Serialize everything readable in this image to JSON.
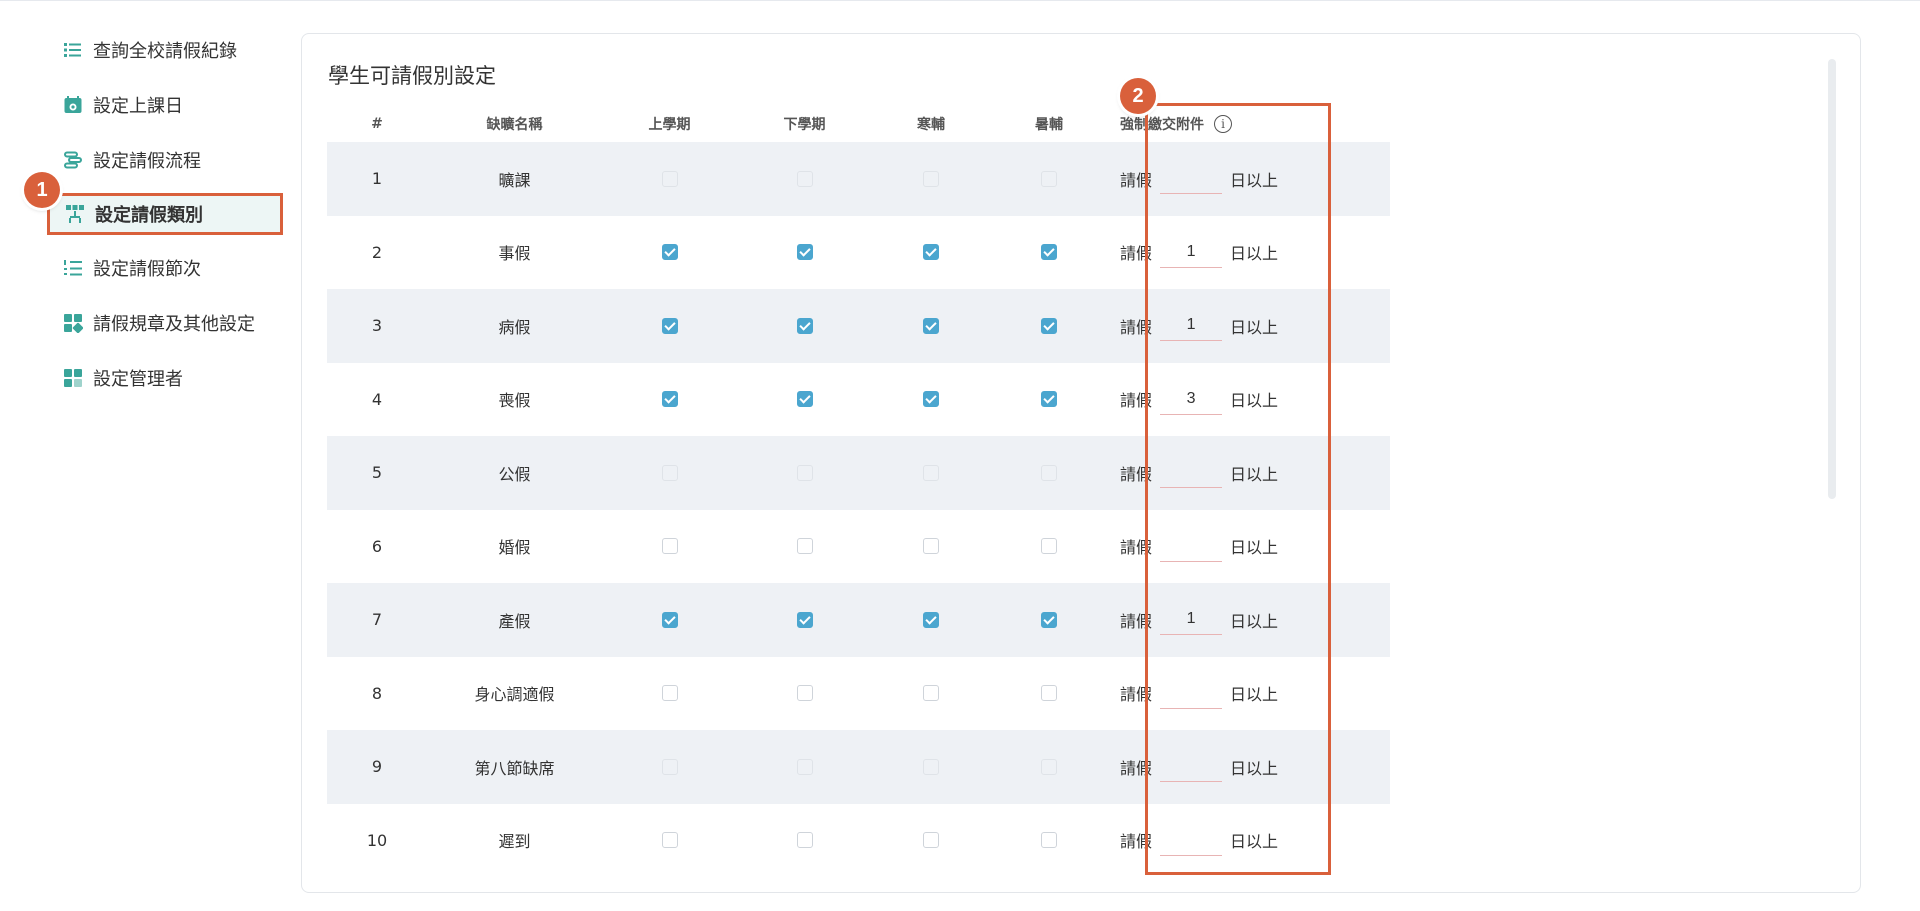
{
  "sidebar": {
    "items": [
      {
        "label": "查詢全校請假紀錄",
        "icon": "list-icon",
        "active": false
      },
      {
        "label": "設定上課日",
        "icon": "calendar-icon",
        "active": false
      },
      {
        "label": "設定請假流程",
        "icon": "flow-icon",
        "active": false
      },
      {
        "label": "設定請假類別",
        "icon": "category-icon",
        "active": true
      },
      {
        "label": "設定請假節次",
        "icon": "numbered-list-icon",
        "active": false
      },
      {
        "label": "請假規章及其他設定",
        "icon": "grid-icon",
        "active": false
      },
      {
        "label": "設定管理者",
        "icon": "admin-icon",
        "active": false
      }
    ]
  },
  "badges": {
    "one": "1",
    "two": "2"
  },
  "card": {
    "title": "學生可請假別設定"
  },
  "table": {
    "headers": {
      "num": "#",
      "name": "缺曠名稱",
      "sem1": "上學期",
      "sem2": "下學期",
      "winter": "寒輔",
      "summer": "暑輔",
      "attachment": "強制繳交附件",
      "info_icon": "i"
    },
    "attachment_prefix": "請假",
    "attachment_suffix": "日以上",
    "rows": [
      {
        "num": "1",
        "name": "曠課",
        "checks": [
          false,
          false,
          false,
          false
        ],
        "disabled": true,
        "days": ""
      },
      {
        "num": "2",
        "name": "事假",
        "checks": [
          true,
          true,
          true,
          true
        ],
        "disabled": false,
        "days": "1"
      },
      {
        "num": "3",
        "name": "病假",
        "checks": [
          true,
          true,
          true,
          true
        ],
        "disabled": false,
        "days": "1"
      },
      {
        "num": "4",
        "name": "喪假",
        "checks": [
          true,
          true,
          true,
          true
        ],
        "disabled": false,
        "days": "3"
      },
      {
        "num": "5",
        "name": "公假",
        "checks": [
          false,
          false,
          false,
          false
        ],
        "disabled": true,
        "days": ""
      },
      {
        "num": "6",
        "name": "婚假",
        "checks": [
          false,
          false,
          false,
          false
        ],
        "disabled": false,
        "days": ""
      },
      {
        "num": "7",
        "name": "產假",
        "checks": [
          true,
          true,
          true,
          true
        ],
        "disabled": false,
        "days": "1"
      },
      {
        "num": "8",
        "name": "身心調適假",
        "checks": [
          false,
          false,
          false,
          false
        ],
        "disabled": false,
        "days": ""
      },
      {
        "num": "9",
        "name": "第八節缺席",
        "checks": [
          false,
          false,
          false,
          false
        ],
        "disabled": true,
        "days": ""
      },
      {
        "num": "10",
        "name": "遲到",
        "checks": [
          false,
          false,
          false,
          false
        ],
        "disabled": false,
        "days": ""
      }
    ]
  },
  "colors": {
    "accent": "#d9603b",
    "check": "#4ba6cf",
    "icon": "#3aa59a",
    "row_alt": "#eef1f5"
  }
}
